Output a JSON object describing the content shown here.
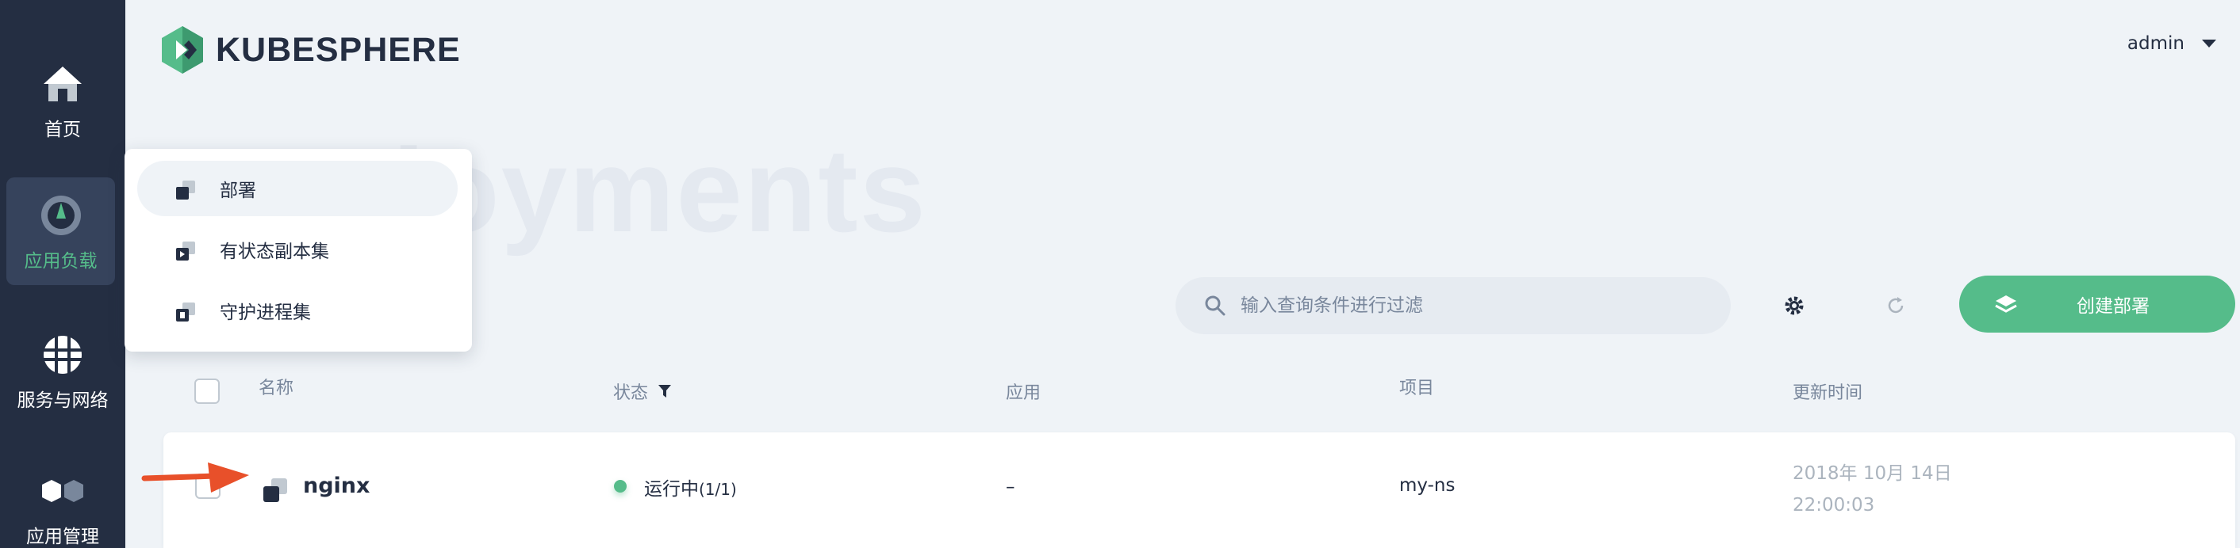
{
  "sidebar": {
    "items": [
      {
        "label": "首页",
        "icon": "home-icon"
      },
      {
        "label": "应用负载",
        "icon": "workload-icon",
        "active": true
      },
      {
        "label": "服务与网络",
        "icon": "network-icon"
      },
      {
        "label": "应用管理",
        "icon": "app-management-icon"
      }
    ]
  },
  "header": {
    "logo_text": "KUBESPHERE",
    "user": "admin"
  },
  "watermark": "Deployments",
  "dropdown": {
    "items": [
      {
        "label": "部署",
        "icon": "deployment-icon",
        "active": true
      },
      {
        "label": "有状态副本集",
        "icon": "statefulset-icon"
      },
      {
        "label": "守护进程集",
        "icon": "daemonset-icon"
      }
    ]
  },
  "toolbar": {
    "search_placeholder": "输入查询条件进行过滤",
    "create_label": "创建部署"
  },
  "table": {
    "columns": {
      "name": "名称",
      "status": "状态",
      "app": "应用",
      "project": "项目",
      "updated": "更新时间"
    },
    "rows": [
      {
        "name": "nginx",
        "status": "运行中",
        "replicas": "(1/1)",
        "app": "–",
        "project": "my-ns",
        "updated_date": "2018年 10月 14日",
        "updated_time": "22:00:03"
      }
    ]
  },
  "colors": {
    "sidebar_bg": "#242e42",
    "accent_green": "#55bc8a",
    "page_bg": "#eff3f7",
    "annotation_arrow": "#e8502a"
  }
}
